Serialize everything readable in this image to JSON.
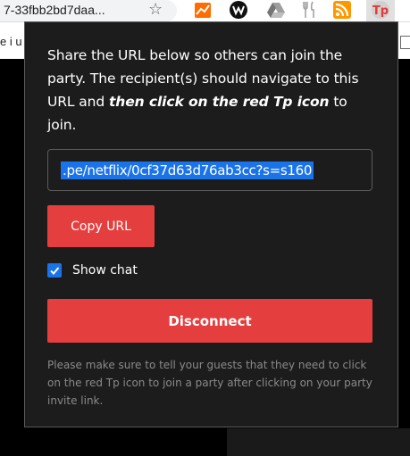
{
  "browser": {
    "url_fragment": "7-33fbb2bd7daa...",
    "icons": [
      "star-icon",
      "orange-chart-extension-icon",
      "w-extension-icon",
      "drive-icon",
      "fork-knife-extension-icon",
      "rss-icon",
      "teleparty-icon"
    ]
  },
  "page_background": {
    "text_fragment": "e i u"
  },
  "popup": {
    "intro_part1": "Share the URL below so others can join the party. The recipient(s) should navigate to this URL and ",
    "intro_emphasis": "then click on the red Tp icon",
    "intro_part2": " to join.",
    "share_url": ".pe/netflix/0cf37d63d76ab3cc?s=s160",
    "copy_button_label": "Copy URL",
    "show_chat_label": "Show chat",
    "show_chat_checked": true,
    "disconnect_button_label": "Disconnect",
    "note": "Please make sure to tell your guests that they need to click on the red Tp icon to join a party after clicking on your party invite link."
  },
  "colors": {
    "accent_red": "#e53e3e",
    "checkbox_blue": "#1a73e8",
    "popup_bg": "#1c1c1c"
  }
}
